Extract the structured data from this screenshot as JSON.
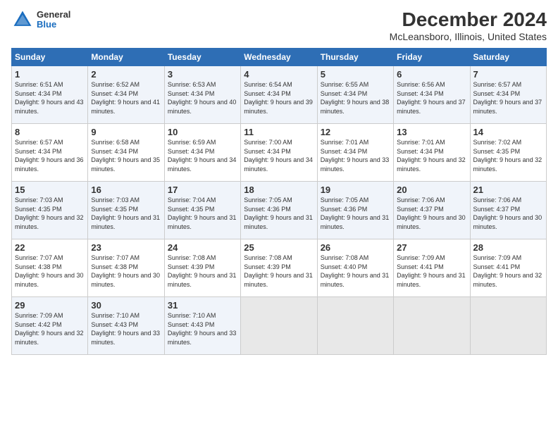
{
  "logo": {
    "general": "General",
    "blue": "Blue"
  },
  "title": "December 2024",
  "subtitle": "McLeansboro, Illinois, United States",
  "headers": [
    "Sunday",
    "Monday",
    "Tuesday",
    "Wednesday",
    "Thursday",
    "Friday",
    "Saturday"
  ],
  "weeks": [
    [
      {
        "day": "1",
        "sunrise": "6:51 AM",
        "sunset": "4:34 PM",
        "daylight": "9 hours and 43 minutes."
      },
      {
        "day": "2",
        "sunrise": "6:52 AM",
        "sunset": "4:34 PM",
        "daylight": "9 hours and 41 minutes."
      },
      {
        "day": "3",
        "sunrise": "6:53 AM",
        "sunset": "4:34 PM",
        "daylight": "9 hours and 40 minutes."
      },
      {
        "day": "4",
        "sunrise": "6:54 AM",
        "sunset": "4:34 PM",
        "daylight": "9 hours and 39 minutes."
      },
      {
        "day": "5",
        "sunrise": "6:55 AM",
        "sunset": "4:34 PM",
        "daylight": "9 hours and 38 minutes."
      },
      {
        "day": "6",
        "sunrise": "6:56 AM",
        "sunset": "4:34 PM",
        "daylight": "9 hours and 37 minutes."
      },
      {
        "day": "7",
        "sunrise": "6:57 AM",
        "sunset": "4:34 PM",
        "daylight": "9 hours and 37 minutes."
      }
    ],
    [
      {
        "day": "8",
        "sunrise": "6:57 AM",
        "sunset": "4:34 PM",
        "daylight": "9 hours and 36 minutes."
      },
      {
        "day": "9",
        "sunrise": "6:58 AM",
        "sunset": "4:34 PM",
        "daylight": "9 hours and 35 minutes."
      },
      {
        "day": "10",
        "sunrise": "6:59 AM",
        "sunset": "4:34 PM",
        "daylight": "9 hours and 34 minutes."
      },
      {
        "day": "11",
        "sunrise": "7:00 AM",
        "sunset": "4:34 PM",
        "daylight": "9 hours and 34 minutes."
      },
      {
        "day": "12",
        "sunrise": "7:01 AM",
        "sunset": "4:34 PM",
        "daylight": "9 hours and 33 minutes."
      },
      {
        "day": "13",
        "sunrise": "7:01 AM",
        "sunset": "4:34 PM",
        "daylight": "9 hours and 32 minutes."
      },
      {
        "day": "14",
        "sunrise": "7:02 AM",
        "sunset": "4:35 PM",
        "daylight": "9 hours and 32 minutes."
      }
    ],
    [
      {
        "day": "15",
        "sunrise": "7:03 AM",
        "sunset": "4:35 PM",
        "daylight": "9 hours and 32 minutes."
      },
      {
        "day": "16",
        "sunrise": "7:03 AM",
        "sunset": "4:35 PM",
        "daylight": "9 hours and 31 minutes."
      },
      {
        "day": "17",
        "sunrise": "7:04 AM",
        "sunset": "4:35 PM",
        "daylight": "9 hours and 31 minutes."
      },
      {
        "day": "18",
        "sunrise": "7:05 AM",
        "sunset": "4:36 PM",
        "daylight": "9 hours and 31 minutes."
      },
      {
        "day": "19",
        "sunrise": "7:05 AM",
        "sunset": "4:36 PM",
        "daylight": "9 hours and 31 minutes."
      },
      {
        "day": "20",
        "sunrise": "7:06 AM",
        "sunset": "4:37 PM",
        "daylight": "9 hours and 30 minutes."
      },
      {
        "day": "21",
        "sunrise": "7:06 AM",
        "sunset": "4:37 PM",
        "daylight": "9 hours and 30 minutes."
      }
    ],
    [
      {
        "day": "22",
        "sunrise": "7:07 AM",
        "sunset": "4:38 PM",
        "daylight": "9 hours and 30 minutes."
      },
      {
        "day": "23",
        "sunrise": "7:07 AM",
        "sunset": "4:38 PM",
        "daylight": "9 hours and 30 minutes."
      },
      {
        "day": "24",
        "sunrise": "7:08 AM",
        "sunset": "4:39 PM",
        "daylight": "9 hours and 31 minutes."
      },
      {
        "day": "25",
        "sunrise": "7:08 AM",
        "sunset": "4:39 PM",
        "daylight": "9 hours and 31 minutes."
      },
      {
        "day": "26",
        "sunrise": "7:08 AM",
        "sunset": "4:40 PM",
        "daylight": "9 hours and 31 minutes."
      },
      {
        "day": "27",
        "sunrise": "7:09 AM",
        "sunset": "4:41 PM",
        "daylight": "9 hours and 31 minutes."
      },
      {
        "day": "28",
        "sunrise": "7:09 AM",
        "sunset": "4:41 PM",
        "daylight": "9 hours and 32 minutes."
      }
    ],
    [
      {
        "day": "29",
        "sunrise": "7:09 AM",
        "sunset": "4:42 PM",
        "daylight": "9 hours and 32 minutes."
      },
      {
        "day": "30",
        "sunrise": "7:10 AM",
        "sunset": "4:43 PM",
        "daylight": "9 hours and 33 minutes."
      },
      {
        "day": "31",
        "sunrise": "7:10 AM",
        "sunset": "4:43 PM",
        "daylight": "9 hours and 33 minutes."
      },
      null,
      null,
      null,
      null
    ]
  ]
}
